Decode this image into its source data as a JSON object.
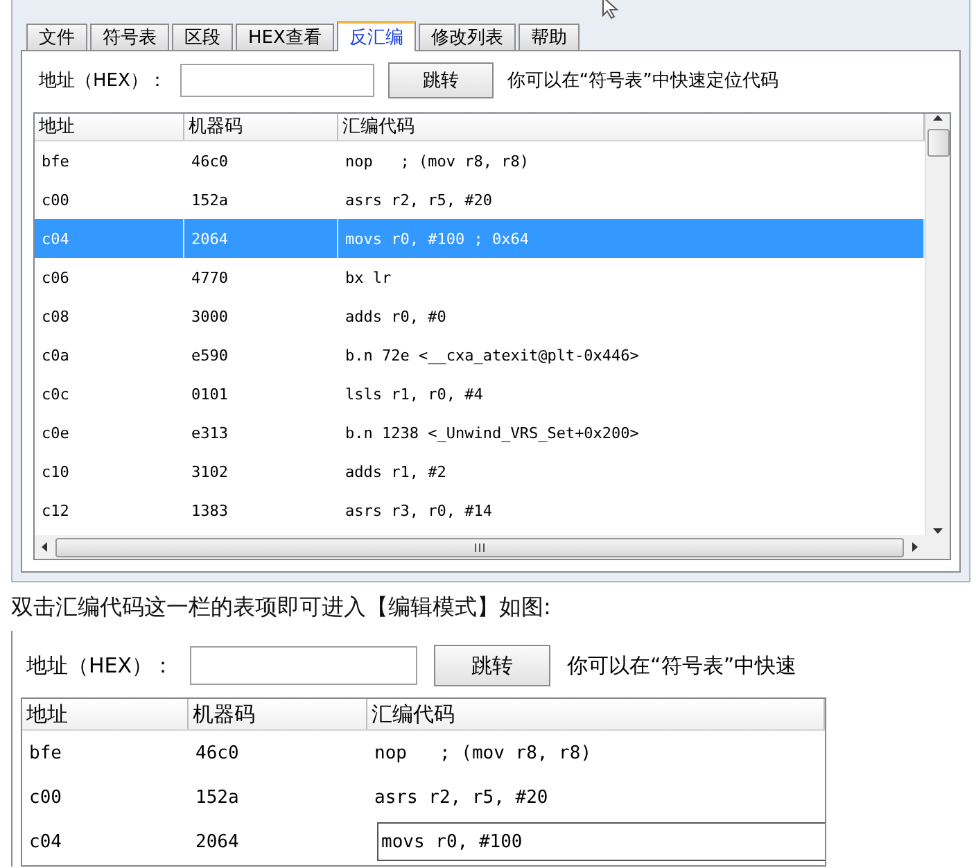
{
  "tabs": [
    {
      "label": "文件",
      "selected": false
    },
    {
      "label": "符号表",
      "selected": false
    },
    {
      "label": "区段",
      "selected": false
    },
    {
      "label": "HEX查看",
      "selected": false
    },
    {
      "label": "反汇编",
      "selected": true
    },
    {
      "label": "修改列表",
      "selected": false
    },
    {
      "label": "帮助",
      "selected": false
    }
  ],
  "toolbar": {
    "address_label": "地址（HEX）：",
    "jump_button": "跳转",
    "hint": "你可以在“符号表”中快速定位代码"
  },
  "table": {
    "columns": [
      "地址",
      "机器码",
      "汇编代码"
    ],
    "rows": [
      {
        "cells": [
          "bfe",
          "46c0",
          "nop   ; (mov r8, r8)"
        ],
        "selected": false
      },
      {
        "cells": [
          "c00",
          "152a",
          "asrs r2, r5, #20"
        ],
        "selected": false
      },
      {
        "cells": [
          "c04",
          "2064",
          "movs r0, #100 ; 0x64"
        ],
        "selected": true
      },
      {
        "cells": [
          "c06",
          "4770",
          "bx lr"
        ],
        "selected": false
      },
      {
        "cells": [
          "c08",
          "3000",
          "adds r0, #0"
        ],
        "selected": false
      },
      {
        "cells": [
          "c0a",
          "e590",
          "b.n 72e <__cxa_atexit@plt-0x446>"
        ],
        "selected": false
      },
      {
        "cells": [
          "c0c",
          "0101",
          "lsls r1, r0, #4"
        ],
        "selected": false
      },
      {
        "cells": [
          "c0e",
          "e313",
          "b.n 1238 <_Unwind_VRS_Set+0x200>"
        ],
        "selected": false
      },
      {
        "cells": [
          "c10",
          "3102",
          "adds r1, #2"
        ],
        "selected": false
      },
      {
        "cells": [
          "c12",
          "1383",
          "asrs r3, r0, #14"
        ],
        "selected": false
      }
    ]
  },
  "caption": "双击汇编代码这一栏的表项即可进入【编辑模式】如图:",
  "edit_view": {
    "toolbar": {
      "address_label": "地址（HEX）：",
      "jump_button": "跳转",
      "hint": "你可以在“符号表”中快速"
    },
    "table": {
      "columns": [
        "地址",
        "机器码",
        "汇编代码"
      ],
      "rows": [
        {
          "cells": [
            "bfe",
            "46c0",
            "nop   ; (mov r8, r8)"
          ],
          "editing": false
        },
        {
          "cells": [
            "c00",
            "152a",
            "asrs r2, r5, #20"
          ],
          "editing": false
        },
        {
          "cells": [
            "c04",
            "2064",
            "movs r0, #100"
          ],
          "editing": true
        }
      ]
    }
  }
}
